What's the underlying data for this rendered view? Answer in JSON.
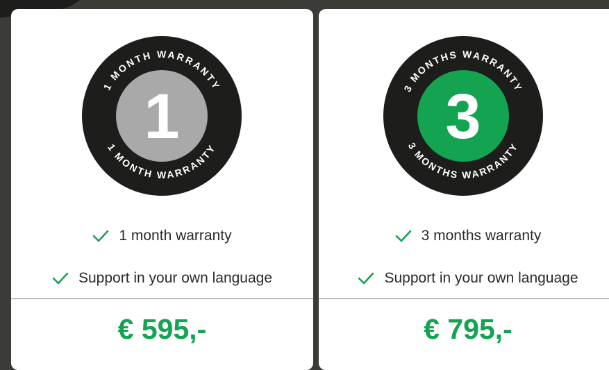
{
  "colors": {
    "accent_green": "#13a351",
    "badge_dark": "#1d1d1b",
    "badge_grey": "#a8a9a8"
  },
  "plans": [
    {
      "badge": {
        "number": "1",
        "ring_text_top": "1 MONTH WARRANTY",
        "ring_text_bottom": "1 MONTH WARRANTY"
      },
      "features": [
        "1 month warranty",
        "Support in your own language"
      ],
      "price": "€ 595,-"
    },
    {
      "badge": {
        "number": "3",
        "ring_text_top": "3 MONTHS WARRANTY",
        "ring_text_bottom": "3 MONTHS WARRANTY"
      },
      "features": [
        "3 months warranty",
        "Support in your own language"
      ],
      "price": "€ 795,-"
    }
  ],
  "icons": {
    "feature": "check-icon"
  }
}
